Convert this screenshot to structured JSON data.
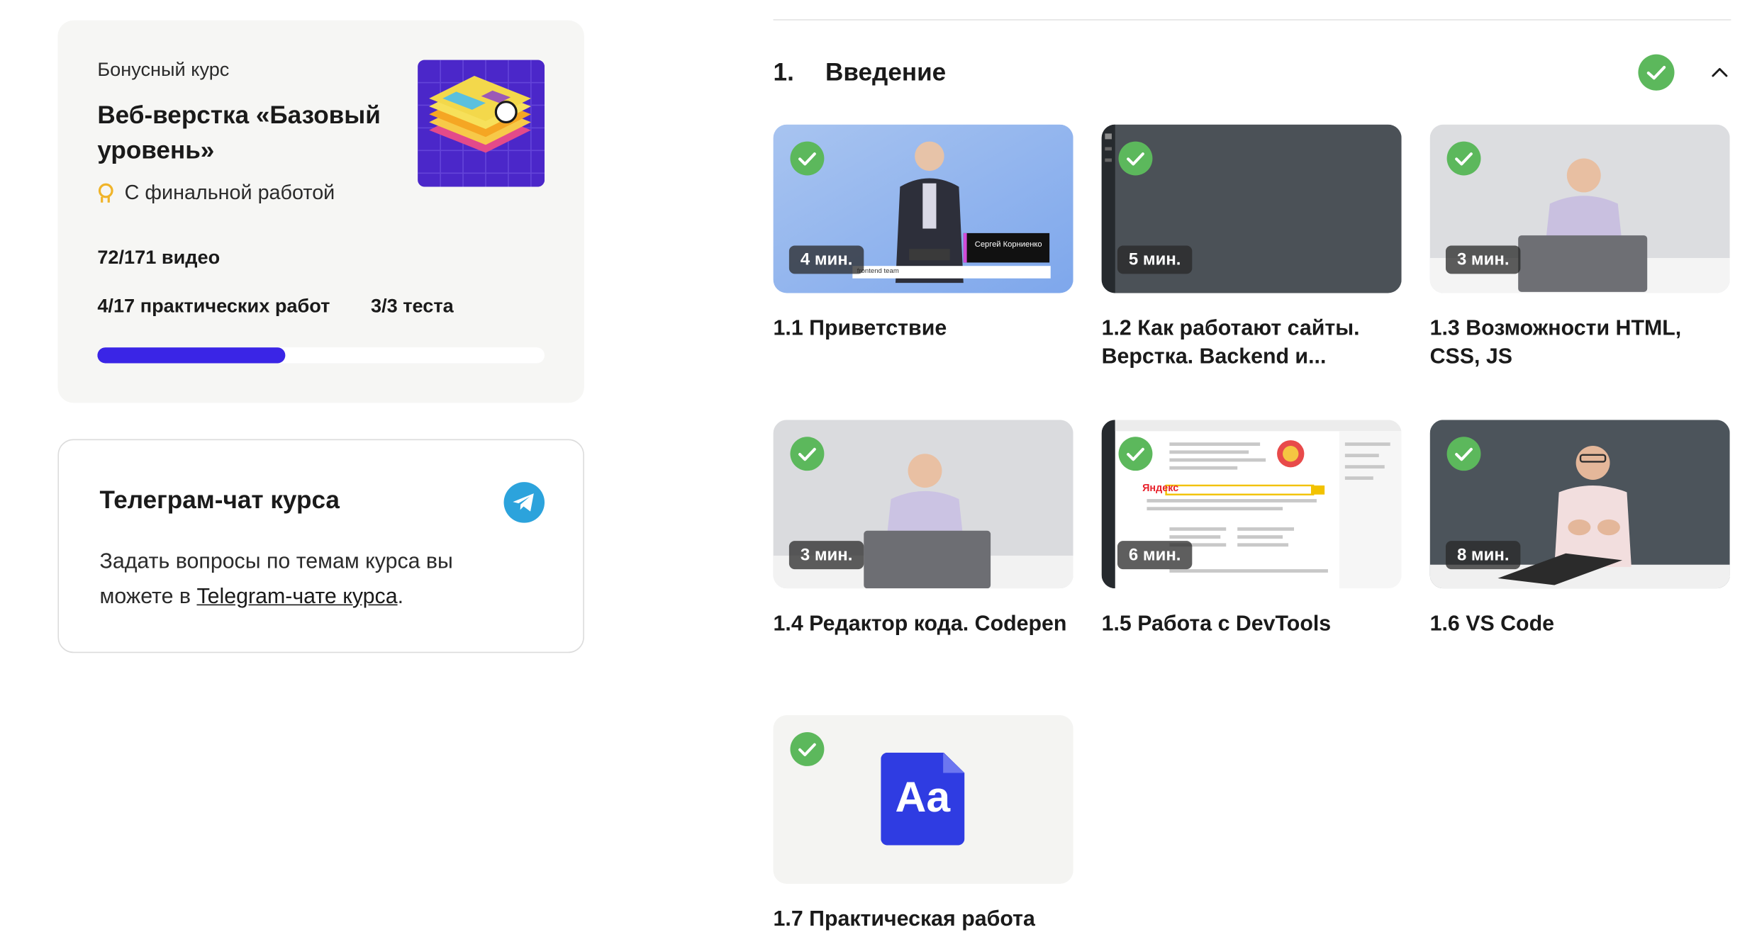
{
  "course": {
    "label": "Бонусный курс",
    "title": "Веб-верстка «Базовый уровень»",
    "final_work": "С финальной работой",
    "videos": "72/171 видео",
    "practical": "4/17 практических работ",
    "tests": "3/3 теста",
    "progress": 0.42,
    "thumb_icon": "course-cover-image"
  },
  "telegram": {
    "title": "Телеграм-чат курса",
    "text_before": "Задать вопросы по темам курса вы можете в ",
    "link_text": "Telegram-чате курса",
    "text_after": ".",
    "icon": "telegram-icon"
  },
  "section": {
    "number": "1.",
    "title": "Введение",
    "completed": true
  },
  "lessons": [
    {
      "title": "1.1 Приветствие",
      "duration": "4 мин.",
      "completed": true
    },
    {
      "title": "1.2 Как работают сайты. Верстка. Backend и...",
      "duration": "5 мин.",
      "completed": true
    },
    {
      "title": "1.3 Возможности HTML, CSS, JS",
      "duration": "3 мин.",
      "completed": true
    },
    {
      "title": "1.4 Редактор кода. Codepen",
      "duration": "3 мин.",
      "completed": true
    },
    {
      "title": "1.5 Работа с DevTools",
      "duration": "6 мин.",
      "completed": true
    },
    {
      "title": "1.6 VS Code",
      "duration": "8 мин.",
      "completed": true
    },
    {
      "title": "1.7 Практическая работа",
      "duration": "",
      "completed": true
    }
  ],
  "thumbnail_text": {
    "speaker_name": "Сергей Корниенко",
    "speaker_role": "frontend team",
    "font_glyph": "Aa",
    "search_brand": "Яндекс"
  },
  "colors": {
    "accent": "#3a25e6",
    "check": "#5cb85c",
    "telegram": "#2ca3dc"
  }
}
